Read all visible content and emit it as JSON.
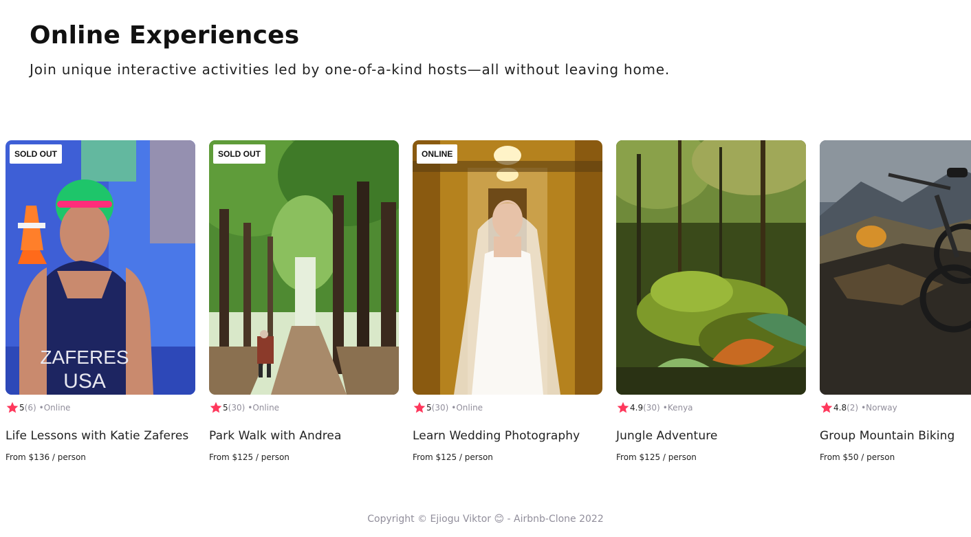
{
  "hero": {
    "title": "Online Experiences",
    "subtitle": "Join unique interactive activities led by one-of-a-kind hosts—all without leaving home."
  },
  "accent_color": "#fe385c",
  "cards": [
    {
      "badge": "SOLD OUT",
      "rating": "5",
      "reviews": "(6)",
      "location": "•Online",
      "title": "Life Lessons with Katie Zaferes",
      "price": "From $136 / person",
      "photo": "swimmer-photo"
    },
    {
      "badge": "SOLD OUT",
      "rating": "5",
      "reviews": "(30)",
      "location": "•Online",
      "title": "Park Walk with Andrea",
      "price": "From $125 / person",
      "photo": "park-walk-photo"
    },
    {
      "badge": "ONLINE",
      "rating": "5",
      "reviews": "(30)",
      "location": "•Online",
      "title": "Learn Wedding Photography",
      "price": "From $125 / person",
      "photo": "bride-photo"
    },
    {
      "badge": "",
      "rating": "4.9",
      "reviews": "(30)",
      "location": "•Kenya",
      "title": "Jungle Adventure",
      "price": "From $125 / person",
      "photo": "jungle-photo"
    },
    {
      "badge": "",
      "rating": "4.8",
      "reviews": "(2)",
      "location": "•Norway",
      "title": "Group Mountain Biking",
      "price": "From $50 / person",
      "photo": "mountain-bike-photo"
    }
  ],
  "footer": {
    "text": "Copyright © Ejiogu Viktor 😊 - Airbnb-Clone 2022"
  }
}
